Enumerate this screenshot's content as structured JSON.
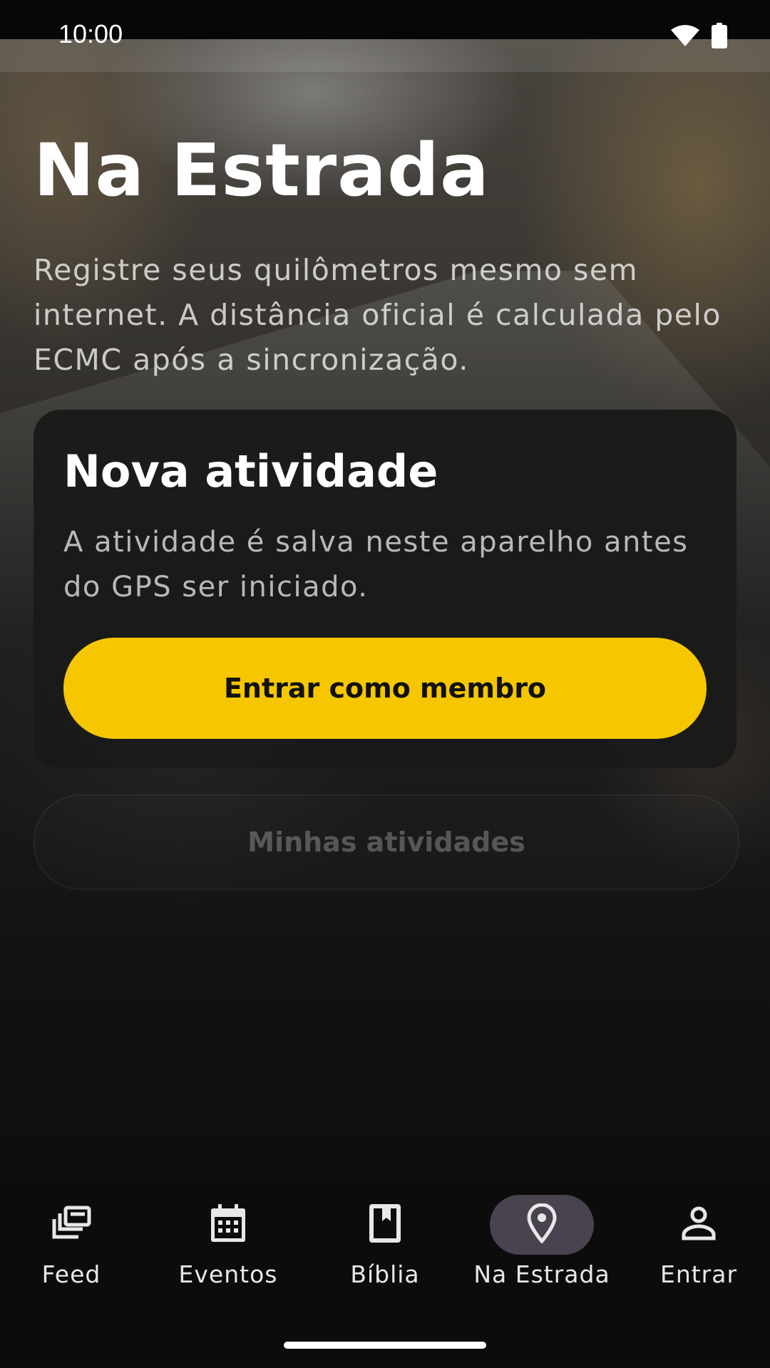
{
  "status_bar": {
    "time": "10:00"
  },
  "page": {
    "title": "Na Estrada",
    "subtitle": "Registre seus quilômetros mesmo sem internet. A distância oficial é calculada pelo ECMC após a sincronização."
  },
  "card": {
    "title": "Nova atividade",
    "description": "A atividade é salva neste aparelho antes do GPS ser iniciado.",
    "primary_button": "Entrar como membro"
  },
  "secondary_button": "Minhas atividades",
  "bottom_nav": {
    "items": [
      {
        "label": "Feed",
        "icon": "feed-icon"
      },
      {
        "label": "Eventos",
        "icon": "calendar-icon"
      },
      {
        "label": "Bíblia",
        "icon": "book-icon"
      },
      {
        "label": "Na Estrada",
        "icon": "location-pin-icon",
        "active": true
      },
      {
        "label": "Entrar",
        "icon": "person-icon"
      }
    ]
  },
  "colors": {
    "accent": "#f6c700",
    "active_nav_bg": "#48434f",
    "card_bg": "#1a1918"
  }
}
